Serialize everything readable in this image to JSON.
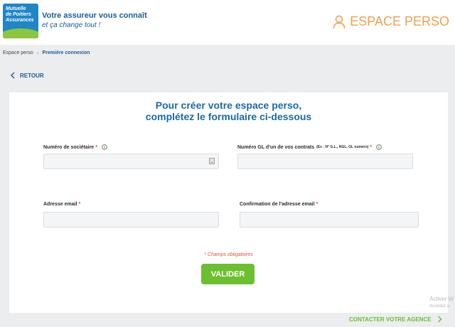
{
  "header": {
    "logo_lines": [
      "Mutuelle",
      "de Poitiers",
      "Assurances"
    ],
    "tagline_main": "Votre assureur vous connaît",
    "tagline_sub": "et ça change tout !",
    "espace_perso_label": "ESPACE PERSO",
    "espace_perso_icon": "user-icon"
  },
  "breadcrumb": {
    "items": [
      "Espace perso",
      "Première connexion"
    ],
    "separator_icon": "chevron-right-icon"
  },
  "back": {
    "label": "RETOUR",
    "icon": "chevron-left-icon"
  },
  "form": {
    "title_line1": "Pour créer votre espace perso,",
    "title_line2": "complétez le formulaire ci-dessous",
    "fields": [
      {
        "label": "Numéro de sociétaire",
        "required_mark": "*",
        "value": "",
        "placeholder": "",
        "has_info": true
      },
      {
        "label": "Numéro GL d'un de vos contrats",
        "hint": "(Ex : N° G.L., NGL, GL numéro)",
        "required_mark": "*",
        "value": "",
        "placeholder": "",
        "has_info": true
      },
      {
        "label": "Adresse email",
        "required_mark": "*",
        "value": "",
        "placeholder": ""
      },
      {
        "label": "Confirmation de l'adresse email",
        "required_mark": "*",
        "value": "",
        "placeholder": ""
      }
    ],
    "required_note": "* Champs obligatoires",
    "submit_label": "VALIDER"
  },
  "footer": {
    "contact_label": "CONTACTER VOTRE AGENCE",
    "contact_icon": "chevron-right-icon",
    "watermark_line1": "Activer W",
    "watermark_line2": "Accédez a"
  },
  "colors": {
    "brand_blue": "#1a5d97",
    "accent_orange": "#f0a04b",
    "action_green": "#6cbf2f",
    "required_red": "#e53935"
  }
}
